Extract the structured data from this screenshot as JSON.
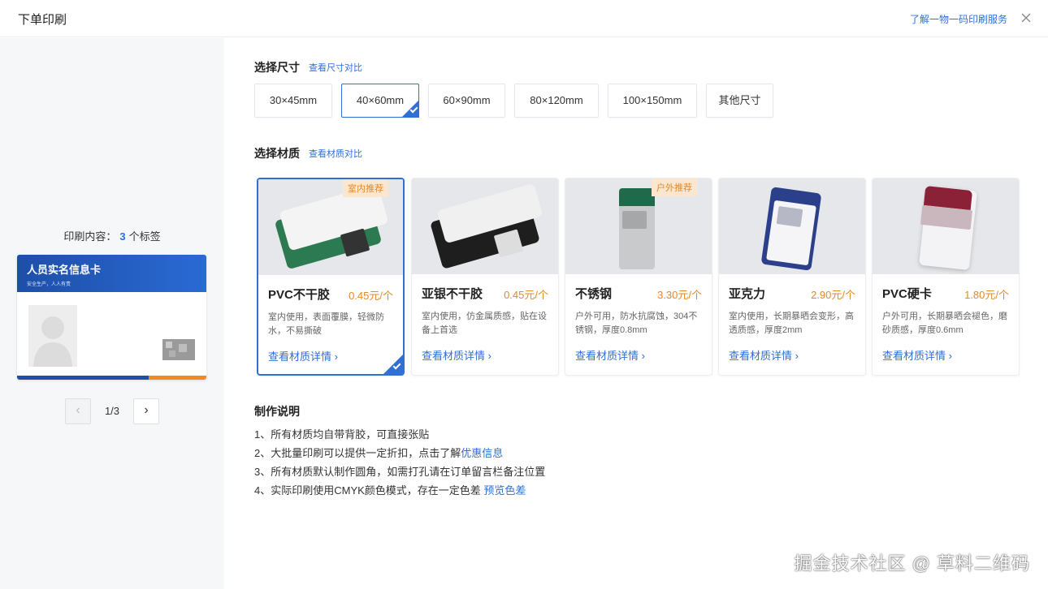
{
  "header": {
    "title": "下单印刷",
    "service_link": "了解一物一码印刷服务"
  },
  "left": {
    "count_prefix": "印刷内容：",
    "count_value": "3",
    "count_suffix": "个标签",
    "card": {
      "title": "人员实名信息卡",
      "subtitle": "安全生产，人人有责"
    },
    "pager": {
      "text": "1/3",
      "prev": "‹",
      "next": "›"
    }
  },
  "size": {
    "title": "选择尺寸",
    "compare_link": "查看尺寸对比",
    "options": [
      "30×45mm",
      "40×60mm",
      "60×90mm",
      "80×120mm",
      "100×150mm",
      "其他尺寸"
    ],
    "selected": "40×60mm"
  },
  "material": {
    "title": "选择材质",
    "compare_link": "查看材质对比",
    "detail_link": "查看材质详情 ›",
    "items": [
      {
        "name": "PVC不干胶",
        "price": "0.45元/个",
        "desc": "室内使用，表面覆膜，轻微防水，不易撕破",
        "badge": "室内推荐"
      },
      {
        "name": "亚银不干胶",
        "price": "0.45元/个",
        "desc": "室内使用，仿金属质感，贴在设备上首选",
        "badge": ""
      },
      {
        "name": "不锈钢",
        "price": "3.30元/个",
        "desc": "户外可用，防水抗腐蚀，304不锈钢，厚度0.8mm",
        "badge": "户外推荐"
      },
      {
        "name": "亚克力",
        "price": "2.90元/个",
        "desc": "室内使用，长期暴晒会变形，高透质感，厚度2mm",
        "badge": ""
      },
      {
        "name": "PVC硬卡",
        "price": "1.80元/个",
        "desc": "户外可用，长期暴晒会褪色，磨砂质感，厚度0.6mm",
        "badge": ""
      }
    ],
    "selected": "PVC不干胶"
  },
  "notes": {
    "title": "制作说明",
    "line1": "1、所有材质均自带背胶，可直接张贴",
    "line2_text": "2、大批量印刷可以提供一定折扣，点击了解",
    "line2_link": "优惠信息",
    "line3": "3、所有材质默认制作圆角，如需打孔请在订单留言栏备注位置",
    "line4_text": "4、实际印刷使用CMYK颜色模式，存在一定色差",
    "line4_link": "预览色差"
  },
  "watermark": "掘金技术社区 @ 草料二维码",
  "colors": {
    "accent": "#2f6fd6",
    "price": "#e08a2b",
    "badge_bg": "#fbe7cf"
  }
}
